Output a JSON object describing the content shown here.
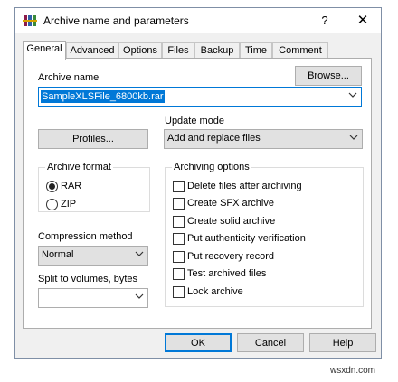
{
  "window": {
    "title": "Archive name and parameters",
    "help_glyph": "?",
    "close_glyph": "✕"
  },
  "tabs": [
    {
      "label": "General",
      "active": true
    },
    {
      "label": "Advanced"
    },
    {
      "label": "Options"
    },
    {
      "label": "Files"
    },
    {
      "label": "Backup"
    },
    {
      "label": "Time"
    },
    {
      "label": "Comment"
    }
  ],
  "archive_name": {
    "label": "Archive name",
    "value": "SampleXLSFile_6800kb.rar",
    "browse_label": "Browse..."
  },
  "update_mode": {
    "label": "Update mode",
    "value": "Add and replace files"
  },
  "profiles_label": "Profiles...",
  "archive_format": {
    "label": "Archive format",
    "options": [
      {
        "label": "RAR",
        "selected": true
      },
      {
        "label": "ZIP",
        "selected": false
      }
    ]
  },
  "compression_method": {
    "label": "Compression method",
    "value": "Normal"
  },
  "split_volumes": {
    "label": "Split to volumes, bytes",
    "value": ""
  },
  "archiving_options": {
    "label": "Archiving options",
    "items": [
      {
        "label": "Delete files after archiving",
        "checked": false
      },
      {
        "label": "Create SFX archive",
        "checked": false
      },
      {
        "label": "Create solid archive",
        "checked": false
      },
      {
        "label": "Put authenticity verification",
        "checked": false
      },
      {
        "label": "Put recovery record",
        "checked": false
      },
      {
        "label": "Test archived files",
        "checked": false
      },
      {
        "label": "Lock archive",
        "checked": false
      }
    ]
  },
  "footer": {
    "ok_label": "OK",
    "cancel_label": "Cancel",
    "help_label": "Help"
  },
  "watermark": "wsxdn.com",
  "colors": {
    "accent": "#0078d7",
    "dialog_bg": "#f0f0f0",
    "button_bg": "#e1e1e1"
  }
}
